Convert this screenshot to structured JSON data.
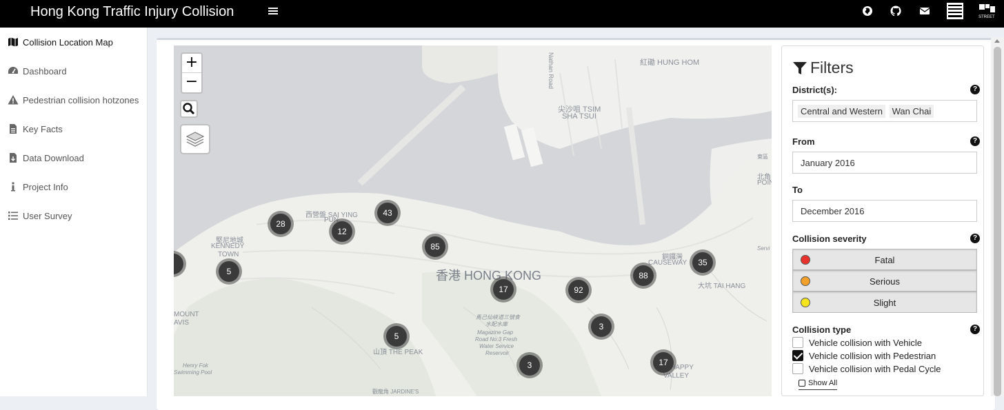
{
  "app": {
    "title": "Hong Kong Traffic Injury Collision"
  },
  "navbar": {
    "icons": [
      "globe-icon",
      "github-icon",
      "envelope-icon",
      "logo-box-icon",
      "streetreset-logo-icon"
    ],
    "logo_text": "STREET"
  },
  "sidebar": {
    "items": [
      {
        "label": "Collision Location Map",
        "icon": "map-icon",
        "active": true
      },
      {
        "label": "Dashboard",
        "icon": "dashboard-icon",
        "active": false
      },
      {
        "label": "Pedestrian collision hotzones",
        "icon": "warning-icon",
        "active": false
      },
      {
        "label": "Key Facts",
        "icon": "file-icon",
        "active": false
      },
      {
        "label": "Data Download",
        "icon": "file-download-icon",
        "active": false
      },
      {
        "label": "Project Info",
        "icon": "info-icon",
        "active": false
      },
      {
        "label": "User Survey",
        "icon": "list-icon",
        "active": false
      }
    ]
  },
  "map": {
    "zoom_in": "+",
    "zoom_out": "−",
    "labels": {
      "hung_hom": "紅磡 HUNG HOM",
      "tsim_sha_tsui_1": "尖沙咀 TSIM",
      "tsim_sha_tsui_2": "SHA TSUI",
      "sai_ying_pun_1": "西營盤 SAI YING",
      "sai_ying_pun_2": "PUN",
      "kennedy_town_1": "堅尼地城",
      "kennedy_town_2": "KENNEDY",
      "kennedy_town_3": "TOWN",
      "hong_kong": "香港 HONG KONG",
      "causeway_1": "銅鑼灣",
      "causeway_2": "CAUSEWAY",
      "tai_hang": "大坑 TAI HANG",
      "mount_davis_1": "MOUNT",
      "mount_davis_2": "AVIS",
      "the_peak": "山頂 THE PEAK",
      "happy_valley_1": "HAPPY",
      "happy_valley_2": "VALLEY",
      "north_point_1": "北角 NC",
      "north_point_2": "POIN",
      "magazine_gap_1": "馬己仙峽道三號食",
      "magazine_gap_2": "水配水庫",
      "magazine_gap_3": "Magazine Gap",
      "magazine_gap_4": "Road No.3 Fresh",
      "magazine_gap_5": "Water Service",
      "magazine_gap_6": "Reservoir",
      "henry_fok_1": "Henry Fok",
      "henry_fok_2": "Swimming Pool",
      "jardines": "觀龍角 JARDINE'S",
      "road_1": "Nathan Road",
      "edge_1": "東區",
      "edge_2": "Servi"
    },
    "clusters": [
      {
        "count": "28"
      },
      {
        "count": "12"
      },
      {
        "count": "43"
      },
      {
        "count": "85"
      },
      {
        "count": "5"
      },
      {
        "count": "17"
      },
      {
        "count": "92"
      },
      {
        "count": "88"
      },
      {
        "count": "35"
      },
      {
        "count": "3"
      },
      {
        "count": "5"
      },
      {
        "count": "3"
      },
      {
        "count": "17"
      }
    ]
  },
  "filters": {
    "title": "Filters",
    "districts_label": "District(s):",
    "districts": [
      "Central and Western",
      "Wan Chai"
    ],
    "from_label": "From",
    "from_value": "January 2016",
    "to_label": "To",
    "to_value": "December 2016",
    "severity_label": "Collision severity",
    "severity": [
      {
        "label": "Fatal",
        "color": "#e8322b"
      },
      {
        "label": "Serious",
        "color": "#f4a12b"
      },
      {
        "label": "Slight",
        "color": "#f5e51c"
      }
    ],
    "type_label": "Collision type",
    "types": [
      {
        "label": "Vehicle collision with Vehicle",
        "checked": false
      },
      {
        "label": "Vehicle collision with Pedestrian",
        "checked": true
      },
      {
        "label": "Vehicle collision with Pedal Cycle",
        "checked": false
      }
    ],
    "show_all": "Show All",
    "help": "?"
  }
}
